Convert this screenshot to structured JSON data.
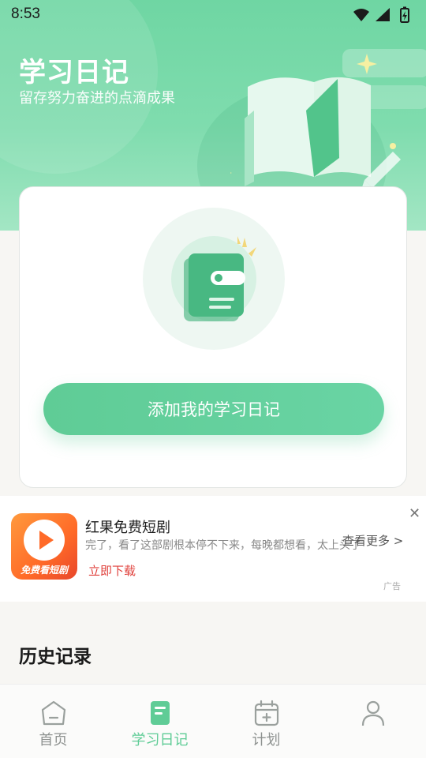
{
  "status_bar": {
    "time": "8:53",
    "icons": [
      "wifi-icon",
      "signal-icon",
      "battery-icon"
    ]
  },
  "header": {
    "title": "学习日记",
    "subtitle": "留存努力奋进的点滴成果"
  },
  "main_card": {
    "add_button_label": "添加我的学习日记"
  },
  "ad": {
    "logo_text": "免费看短剧",
    "title": "红果免费短剧",
    "description": "完了，看了这部剧根本停不下来，每晚都想看，太上头了",
    "more_label": "查看更多 >",
    "cta_label": "立即下载",
    "close_label": "✕",
    "ad_tag": "广告"
  },
  "history": {
    "title": "历史记录"
  },
  "bottom_nav": {
    "items": [
      {
        "label": "首页",
        "icon": "home-icon",
        "active": false
      },
      {
        "label": "学习日记",
        "icon": "diary-icon",
        "active": true
      },
      {
        "label": "计划",
        "icon": "calendar-icon",
        "active": false
      },
      {
        "label": "",
        "icon": "profile-icon",
        "active": false
      }
    ]
  },
  "colors": {
    "accent": "#5fcc96",
    "header_green": "#7fdcae",
    "ad_cta": "#e0423d"
  }
}
